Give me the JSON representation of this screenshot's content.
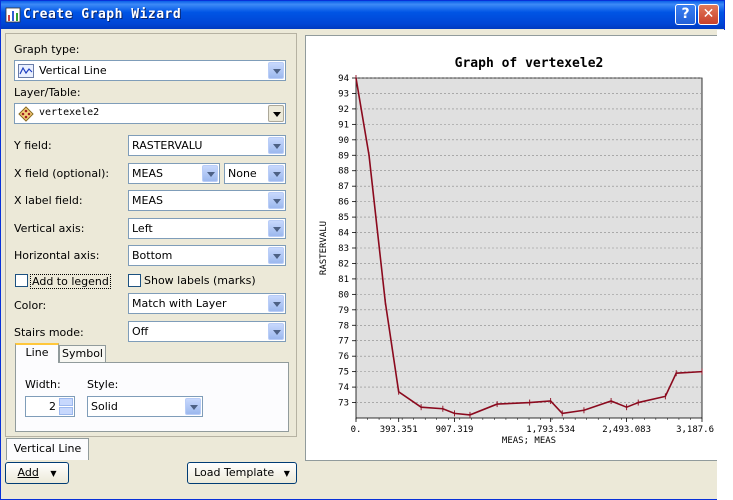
{
  "window": {
    "title": "Create Graph Wizard",
    "help_label": "?",
    "close_label": "✕"
  },
  "form": {
    "graph_type_label": "Graph type:",
    "graph_type_value": "Vertical Line",
    "layer_label": "Layer/Table:",
    "layer_value": "vertexele2",
    "y_field_label": "Y field:",
    "y_field_value": "RASTERVALU",
    "x_field_label": "X field (optional):",
    "x_field_value": "MEAS",
    "x_field_norm": "None",
    "x_label_label": "X label field:",
    "x_label_value": "MEAS",
    "vaxis_label": "Vertical axis:",
    "vaxis_value": "Left",
    "haxis_label": "Horizontal axis:",
    "haxis_value": "Bottom",
    "add_legend_label": "Add to legend",
    "show_labels_label": "Show labels (marks)",
    "color_label": "Color:",
    "color_value": "Match with Layer",
    "stairs_label": "Stairs mode:",
    "stairs_value": "Off",
    "tabs": [
      "Line",
      "Symbol"
    ],
    "width_label": "Width:",
    "width_value": "2",
    "style_label": "Style:",
    "style_value": "Solid"
  },
  "bottom": {
    "series_tab": "Vertical Line",
    "add_label": "Add",
    "load_template_label": "Load Template"
  },
  "colors": {
    "line": "#8b0a1e",
    "plot_bg": "#e0e0e0",
    "title_bar": "#0054e3"
  },
  "chart_data": {
    "type": "line",
    "title": "Graph of vertexele2",
    "xlabel": "MEAS; MEAS",
    "ylabel": "RASTERVALU",
    "ylim": [
      72,
      94
    ],
    "xlim": [
      0,
      3187.6
    ],
    "x_tick_values": [
      0,
      393.351,
      907.319,
      1793.534,
      2493.083,
      3187.6
    ],
    "x_tick_labels": [
      "0.",
      "393.351",
      "907.319",
      "1,793.534",
      "2,493.083",
      "3,187.6"
    ],
    "y_ticks": [
      73,
      74,
      75,
      76,
      77,
      78,
      79,
      80,
      81,
      82,
      83,
      84,
      85,
      86,
      87,
      88,
      89,
      90,
      91,
      92,
      93,
      94
    ],
    "grid": "horizontal",
    "series": [
      {
        "x": [
          0,
          120,
          270,
          393,
          600,
          800,
          907,
          1050,
          1300,
          1600,
          1793,
          1900,
          2100,
          2350,
          2493,
          2600,
          2850,
          2950,
          3187.6
        ],
        "y": [
          94,
          89,
          79.5,
          73.7,
          72.7,
          72.6,
          72.3,
          72.2,
          72.9,
          73.0,
          73.1,
          72.3,
          72.5,
          73.1,
          72.7,
          73.0,
          73.4,
          74.9,
          75.0
        ]
      }
    ]
  }
}
